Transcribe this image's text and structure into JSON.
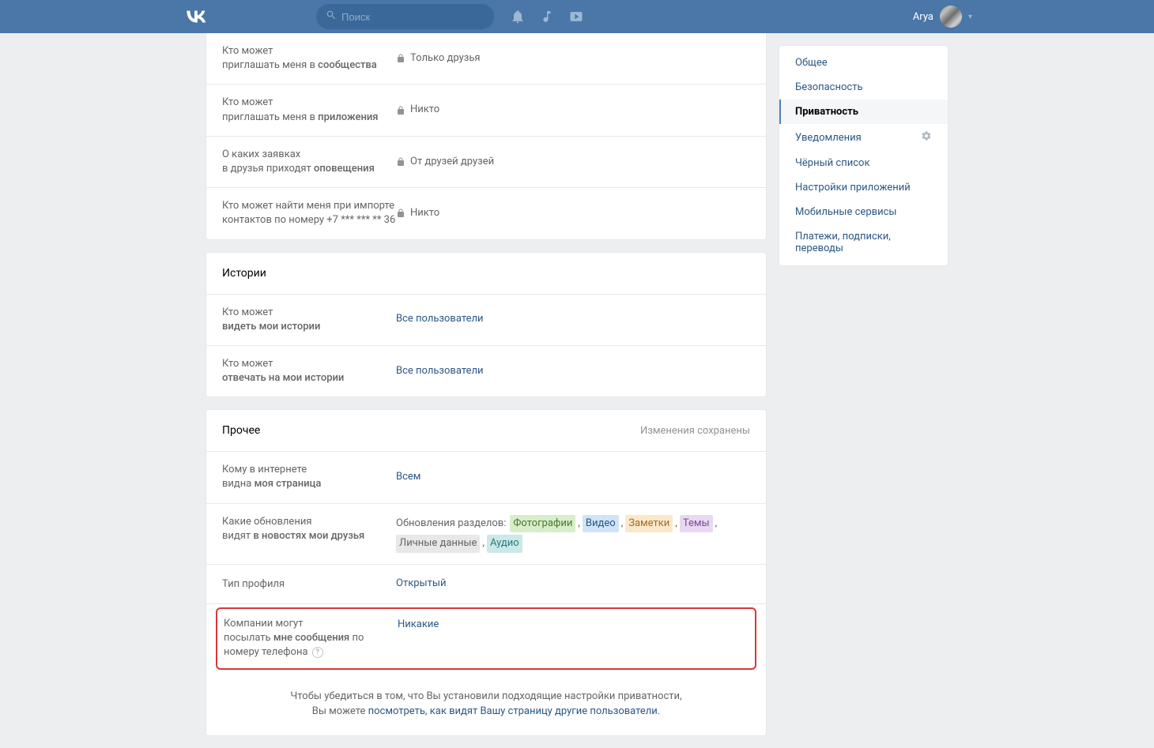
{
  "header": {
    "search_placeholder": "Поиск",
    "username": "Arya"
  },
  "sidebar": {
    "items": [
      {
        "label": "Общее"
      },
      {
        "label": "Безопасность"
      },
      {
        "label": "Приватность"
      },
      {
        "label": "Уведомления"
      },
      {
        "label": "Чёрный список"
      },
      {
        "label": "Настройки приложений"
      },
      {
        "label": "Мобильные сервисы"
      },
      {
        "label": "Платежи, подписки, переводы"
      }
    ]
  },
  "section1": {
    "rows": [
      {
        "label_1": "Кто может",
        "label_2_pre": "приглашать меня в ",
        "label_2_bold": "сообщества",
        "value": "Только друзья",
        "locked": true
      },
      {
        "label_1": "Кто может",
        "label_2_pre": "приглашать меня в ",
        "label_2_bold": "приложения",
        "value": "Никто",
        "locked": true
      },
      {
        "label_1": "О каких заявках",
        "label_2_pre": "в друзья приходят ",
        "label_2_bold": "оповещения",
        "value": "От друзей друзей",
        "locked": true
      },
      {
        "label_1": "Кто может найти меня при импорте контактов по номеру +7 *** *** ** 36",
        "label_2_pre": "",
        "label_2_bold": "",
        "value": "Никто",
        "locked": true
      }
    ]
  },
  "stories": {
    "title": "Истории",
    "rows": [
      {
        "label_1": "Кто может",
        "label_2_bold": "видеть мои истории",
        "value": "Все пользователи"
      },
      {
        "label_1": "Кто может",
        "label_2_bold": "отвечать на мои истории",
        "value": "Все пользователи"
      }
    ]
  },
  "other": {
    "title": "Прочее",
    "saved": "Изменения сохранены",
    "r1": {
      "label_1": "Кому в интернете",
      "label_2_pre": "видна ",
      "label_2_bold": "моя страница",
      "value": "Всем"
    },
    "r2": {
      "label_1": "Какие обновления",
      "label_2_pre": "видят ",
      "label_2_bold": "в новостях мои друзья",
      "prefix": "Обновления разделов:",
      "tags": [
        {
          "text": "Фотографии",
          "cls": "green"
        },
        {
          "text": "Видео",
          "cls": "blue"
        },
        {
          "text": "Заметки",
          "cls": "orange"
        },
        {
          "text": "Темы",
          "cls": "purple"
        },
        {
          "text": "Личные данные",
          "cls": "gray"
        },
        {
          "text": "Аудио",
          "cls": "teal"
        }
      ]
    },
    "r3": {
      "label": "Тип профиля",
      "value": "Открытый"
    },
    "r4": {
      "label_1": "Компании могут",
      "label_2_pre": "посылать ",
      "label_2_bold": "мне сообщения",
      "label_2_post": " по номеру телефона",
      "value": "Никакие"
    }
  },
  "footer": {
    "line1": "Чтобы убедиться в том, что Вы установили подходящие настройки приватности,",
    "line2_pre": "Вы можете ",
    "line2_link": "посмотреть, как видят Вашу страницу другие пользователи."
  }
}
